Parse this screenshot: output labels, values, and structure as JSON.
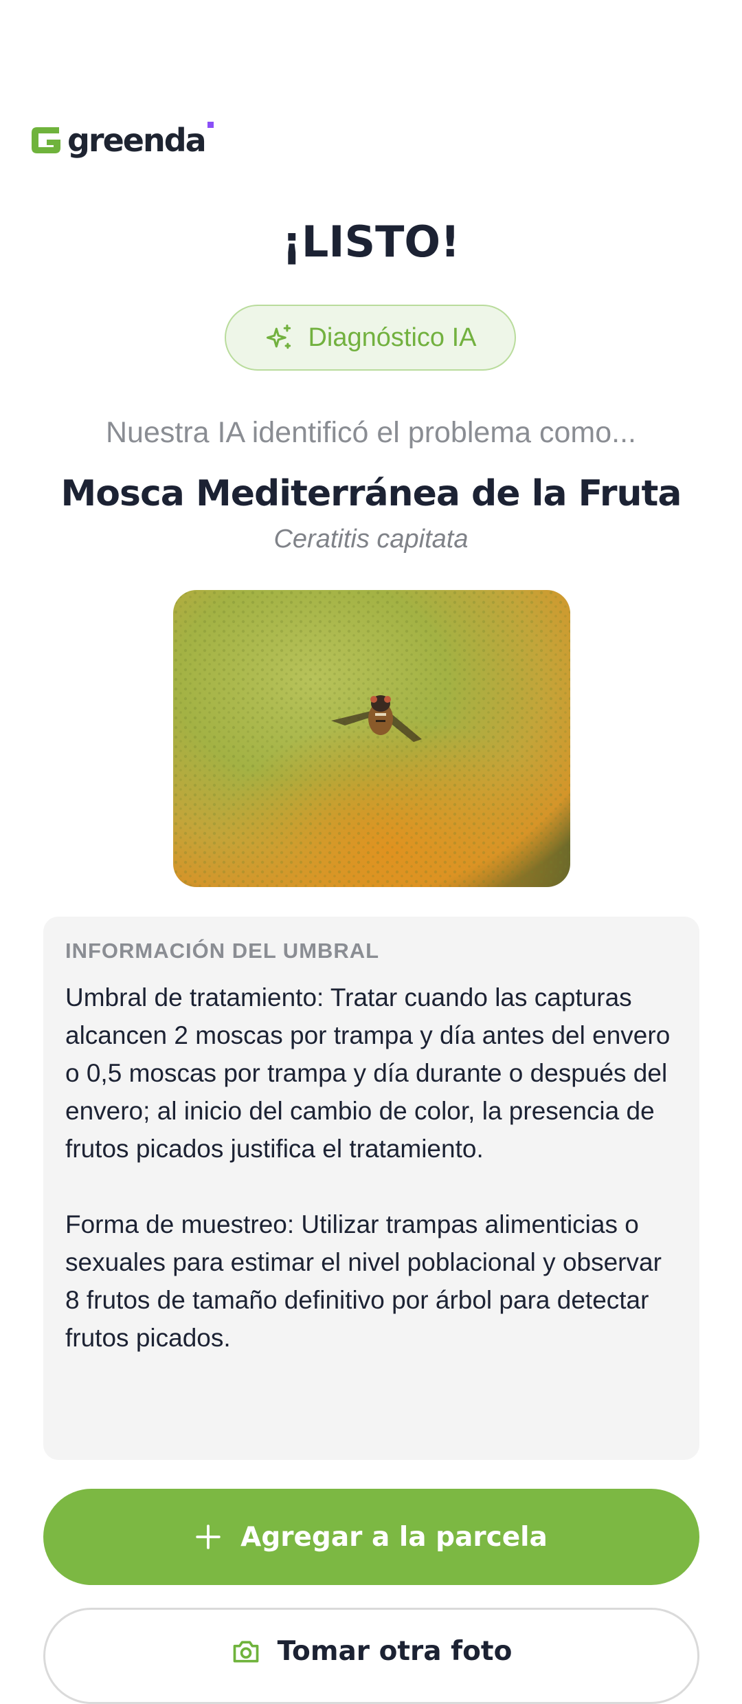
{
  "brand": {
    "name": "greenda",
    "green": "#6fb33c",
    "accent": "#8a4ff7"
  },
  "result": {
    "title": "¡LISTO!",
    "badge_label": "Diagnóstico IA",
    "intro": "Nuestra IA identificó el problema como...",
    "pest_name": "Mosca Mediterránea de la Fruta",
    "scientific_name": "Ceratitis capitata"
  },
  "threshold_info": {
    "heading": "INFORMACIÓN DEL UMBRAL",
    "treatment": "Umbral de tratamiento: Tratar cuando las capturas alcancen 2 moscas por trampa y día antes del envero o 0,5 moscas por trampa y día durante o después del envero; al inicio del cambio de color, la presencia de frutos picados justifica el tratamiento.",
    "sampling": "Forma de muestreo: Utilizar trampas alimenticias o sexuales para estimar el nivel poblacional y observar 8 frutos de tamaño definitivo por árbol para detectar frutos picados."
  },
  "actions": {
    "add_label": "Agregar a la parcela",
    "add_icon": "plus-icon",
    "photo_label": "Tomar otra foto",
    "photo_icon": "camera-icon"
  },
  "icons": {
    "badge": "sparkle-icon"
  }
}
